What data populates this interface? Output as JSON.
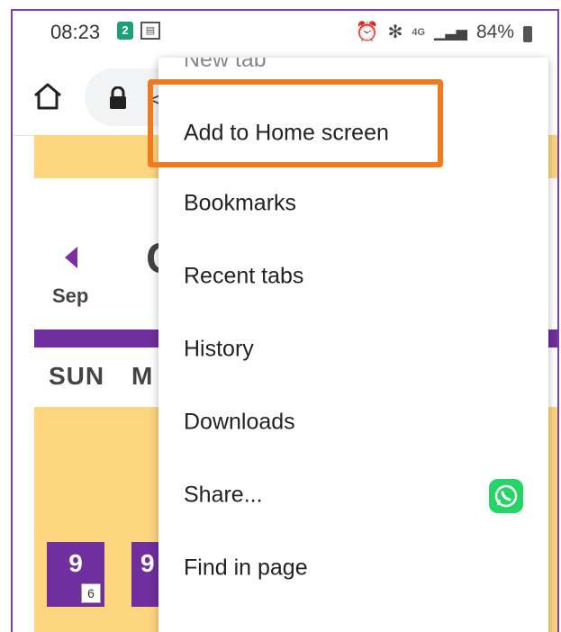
{
  "status_bar": {
    "time": "08:23",
    "notif_calendar": "2",
    "notif_other": "ĦĦ",
    "battery": "84%",
    "network": "4G"
  },
  "toolbar": {
    "url_partial": "<"
  },
  "calendar": {
    "prev_month": "Sep",
    "month_partial": "C",
    "day_sun": "SUN",
    "day_mon": "M",
    "date": "9",
    "date_badge": "6",
    "date_partial": "9"
  },
  "menu": {
    "items": [
      {
        "label": "New tab"
      },
      {
        "label": "Add to Home screen"
      },
      {
        "label": "Bookmarks"
      },
      {
        "label": "Recent tabs"
      },
      {
        "label": "History"
      },
      {
        "label": "Downloads"
      },
      {
        "label": "Share..."
      },
      {
        "label": "Find in page"
      }
    ]
  },
  "colors": {
    "accent_purple": "#6f2f9f",
    "calendar_yellow": "#fcd57e",
    "highlight_orange": "#f07a1e",
    "whatsapp_green": "#25d366"
  }
}
